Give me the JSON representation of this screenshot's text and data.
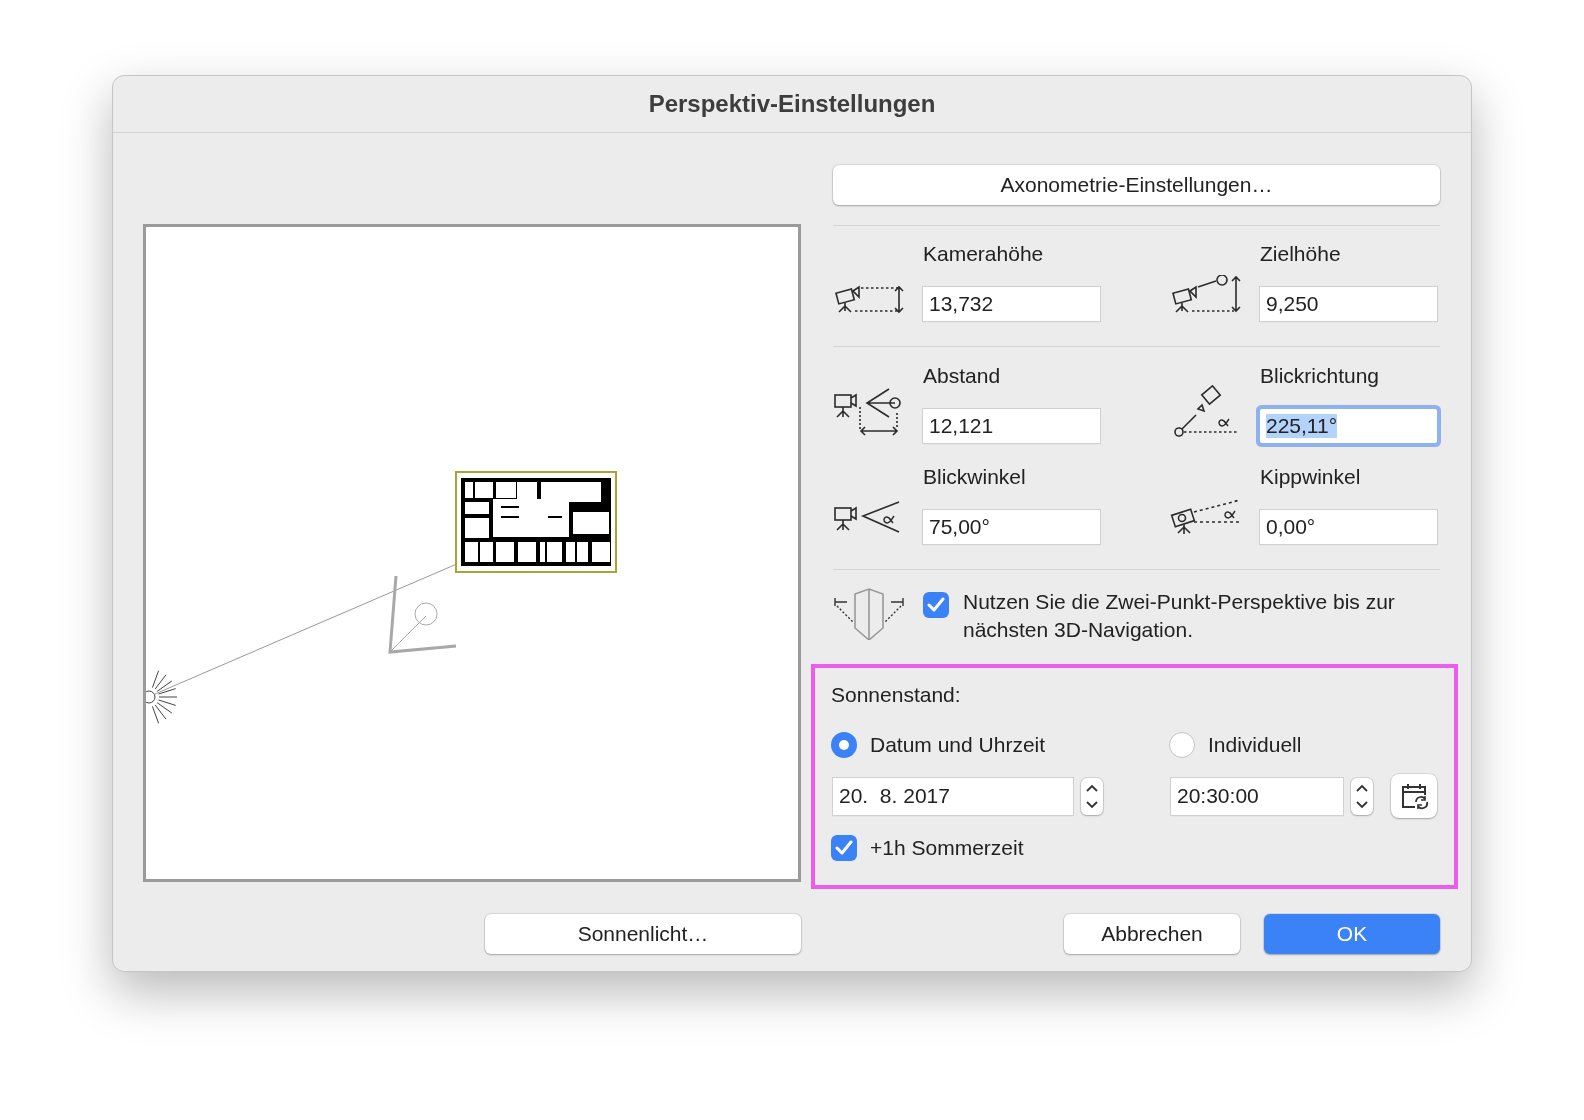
{
  "window": {
    "title": "Perspektiv-Einstellungen"
  },
  "axonometry_button": "Axonometrie-Einstellungen…",
  "parameter_groups": [
    {
      "parameters": [
        {
          "kind": "camera-height",
          "label": "Kamerahöhe",
          "value": "13,732",
          "focused": false
        },
        {
          "kind": "target-height",
          "label": "Zielhöhe",
          "value": "9,250",
          "focused": false
        }
      ]
    },
    {
      "parameters": [
        {
          "kind": "distance",
          "label": "Abstand",
          "value": "12,121",
          "focused": false
        },
        {
          "kind": "direction",
          "label": "Blickrichtung",
          "value": "225,11°",
          "focused": true
        },
        {
          "kind": "view-angle",
          "label": "Blickwinkel",
          "value": "75,00°",
          "focused": false
        },
        {
          "kind": "tilt",
          "label": "Kippwinkel",
          "value": "0,00°",
          "focused": false
        }
      ]
    }
  ],
  "two_point": {
    "label": "Nutzen Sie die Zwei-Punkt-Perspektive bis zur nächsten 3D-Navigation.",
    "checked": true
  },
  "sun": {
    "title": "Sonnenstand:",
    "options": [
      {
        "label": "Datum und Uhrzeit",
        "selected": true
      },
      {
        "label": "Individuell",
        "selected": false
      }
    ],
    "date": "20.  8. 2017",
    "time": "20:30:00",
    "dst": {
      "label": "+1h Sommerzeit",
      "checked": true
    }
  },
  "buttons": [
    {
      "kind": "sunlight",
      "label": "Sonnenlicht…"
    },
    {
      "kind": "cancel",
      "label": "Abbrechen"
    },
    {
      "kind": "default",
      "label": "OK"
    }
  ]
}
